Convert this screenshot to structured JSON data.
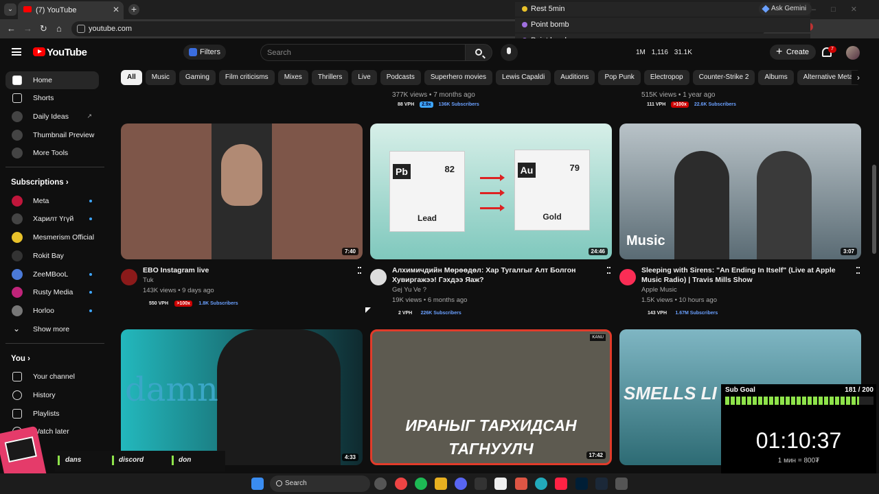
{
  "browser": {
    "tab_title": "(7) YouTube",
    "url": "youtube.com",
    "suggestions": [
      "Rest 5min",
      "Point bomb",
      "Point bomb"
    ],
    "ask_gemini": "Ask Gemini"
  },
  "header": {
    "logo_text": "YouTube",
    "filters_label": "Filters",
    "search_placeholder": "Search",
    "stats": [
      "1M",
      "1,116",
      "31.1K"
    ],
    "create_label": "Create",
    "notif_count": "7"
  },
  "sidebar": {
    "main": [
      {
        "label": "Home",
        "icon": "home-icon"
      },
      {
        "label": "Shorts",
        "icon": "shorts-icon"
      },
      {
        "label": "Daily Ideas",
        "icon": "ideas-icon"
      },
      {
        "label": "Thumbnail Preview",
        "icon": "preview-icon"
      },
      {
        "label": "More Tools",
        "icon": "tools-icon"
      }
    ],
    "subscriptions_title": "Subscriptions",
    "subscriptions": [
      {
        "label": "Meta",
        "color": "#c0163b"
      },
      {
        "label": "Харилт Үгүй",
        "color": "#444"
      },
      {
        "label": "Mesmerism Official",
        "color": "#e8c12a"
      },
      {
        "label": "Rokit Bay",
        "color": "#333"
      },
      {
        "label": "ZeeMBooL",
        "color": "#4b7ad8"
      },
      {
        "label": "Rusty Media",
        "color": "#c0247a"
      },
      {
        "label": "Horloo",
        "color": "#777"
      }
    ],
    "show_more": "Show more",
    "you_title": "You",
    "you_items": [
      {
        "label": "Your channel"
      },
      {
        "label": "History"
      },
      {
        "label": "Playlists"
      },
      {
        "label": "Watch later"
      }
    ]
  },
  "chips": [
    "All",
    "Music",
    "Gaming",
    "Film criticisms",
    "Mixes",
    "Thrillers",
    "Live",
    "Podcasts",
    "Superhero movies",
    "Lewis Capaldi",
    "Auditions",
    "Pop Punk",
    "Electropop",
    "Counter-Strike 2",
    "Albums",
    "Alternative Metal"
  ],
  "top_rows": [
    {
      "stats": "377K views • 7 months ago",
      "vph": "88 VPH",
      "mult": "2.9x",
      "subs": "136K Subscribers"
    },
    {
      "stats": "515K views • 1 year ago",
      "vph": "111 VPH",
      "mult": ">100x",
      "subs": "22.6K Subscribers"
    }
  ],
  "videos": [
    {
      "title": "EBO Instagram live",
      "channel": "Tuk",
      "stats": "143K views • 9 days ago",
      "duration": "7:40",
      "vph": "550 VPH",
      "mult": ">100x",
      "subs": "1.8K Subscribers"
    },
    {
      "title": "Алхимичдийн Мөрөөдөл: Хар Тугалгыг Алт Болгон Хувиргажээ! Гэхдээ Яаж?",
      "channel": "Gej Yu Ve ?",
      "stats": "19K views • 6 months ago",
      "duration": "24:46",
      "vph": "2 VPH",
      "subs": "226K Subscribers",
      "cube1": {
        "sym": "Pb",
        "num": "82",
        "name": "Lead"
      },
      "cube2": {
        "sym": "Au",
        "num": "79",
        "name": "Gold"
      }
    },
    {
      "title": "Sleeping with Sirens: \"An Ending In Itself\" (Live at Apple Music Radio) | Travis Mills Show",
      "channel": "Apple Music",
      "stats": "1.5K views • 10 hours ago",
      "duration": "3:07",
      "vph": "143 VPH",
      "subs": "1.67M Subscribers",
      "overlay": "Music"
    },
    {
      "duration": "4:33",
      "overlay": "damn"
    },
    {
      "duration": "17:42",
      "overlay_lines": [
        "ИРАНЫГ ТАРХИДСАН",
        "ТАГНУУЛЧ"
      ],
      "badge": "KANU"
    },
    {
      "overlay": "SMELLS LI"
    }
  ],
  "widgets": {
    "sub_goal_label": "Sub Goal",
    "sub_goal_value": "181 / 200",
    "sub_goal_progress": 0.905,
    "timer": "01:10:37",
    "timer_sub": "1 мин = 800₮",
    "chat": [
      "dans",
      "discord",
      "don"
    ]
  },
  "taskbar": {
    "search_label": "Search"
  }
}
